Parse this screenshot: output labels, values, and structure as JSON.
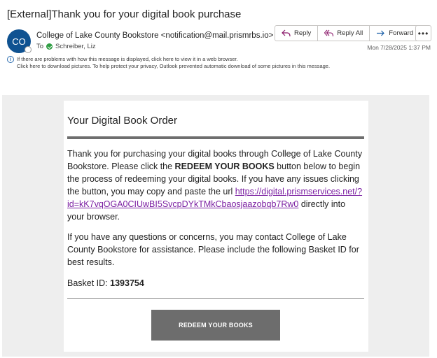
{
  "email": {
    "subject": "[External]Thank you for your digital book purchase",
    "avatar_initials": "CO",
    "sender": "College of Lake County Bookstore <notification@mail.prismrbs.io>",
    "to_label": "To",
    "recipient": "Schreiber, Liz",
    "date": "Mon 7/28/2025 1:37 PM",
    "info_line1": "If there are problems with how this message is displayed, click here to view it in a web browser.",
    "info_line2": "Click here to download pictures. To help protect your privacy, Outlook prevented automatic download of some pictures in this message."
  },
  "actions": {
    "reply": "Reply",
    "reply_all": "Reply All",
    "forward": "Forward",
    "more": "•••"
  },
  "body": {
    "title": "Your Digital Book Order",
    "p1_before": "Thank you for purchasing your digital books through College of Lake County Bookstore. Please click the ",
    "p1_bold": "REDEEM YOUR BOOKS",
    "p1_middle": " button below to begin the process of redeeming your digital books. If you have any issues clicking the button, you may copy and paste the url ",
    "p1_link": "https://digital.prismservices.net/?id=kK7vqOGA0CIUwBI5SvcpDYkTMkCbaosjaazobqb7Rw0",
    "p1_after": " directly into your browser.",
    "p2": "If you have any questions or concerns, you may contact College of Lake County Bookstore for assistance. Please include the following Basket ID for best results.",
    "basket_label": "Basket ID: ",
    "basket_id": "1393754",
    "button": "REDEEM YOUR BOOKS"
  }
}
